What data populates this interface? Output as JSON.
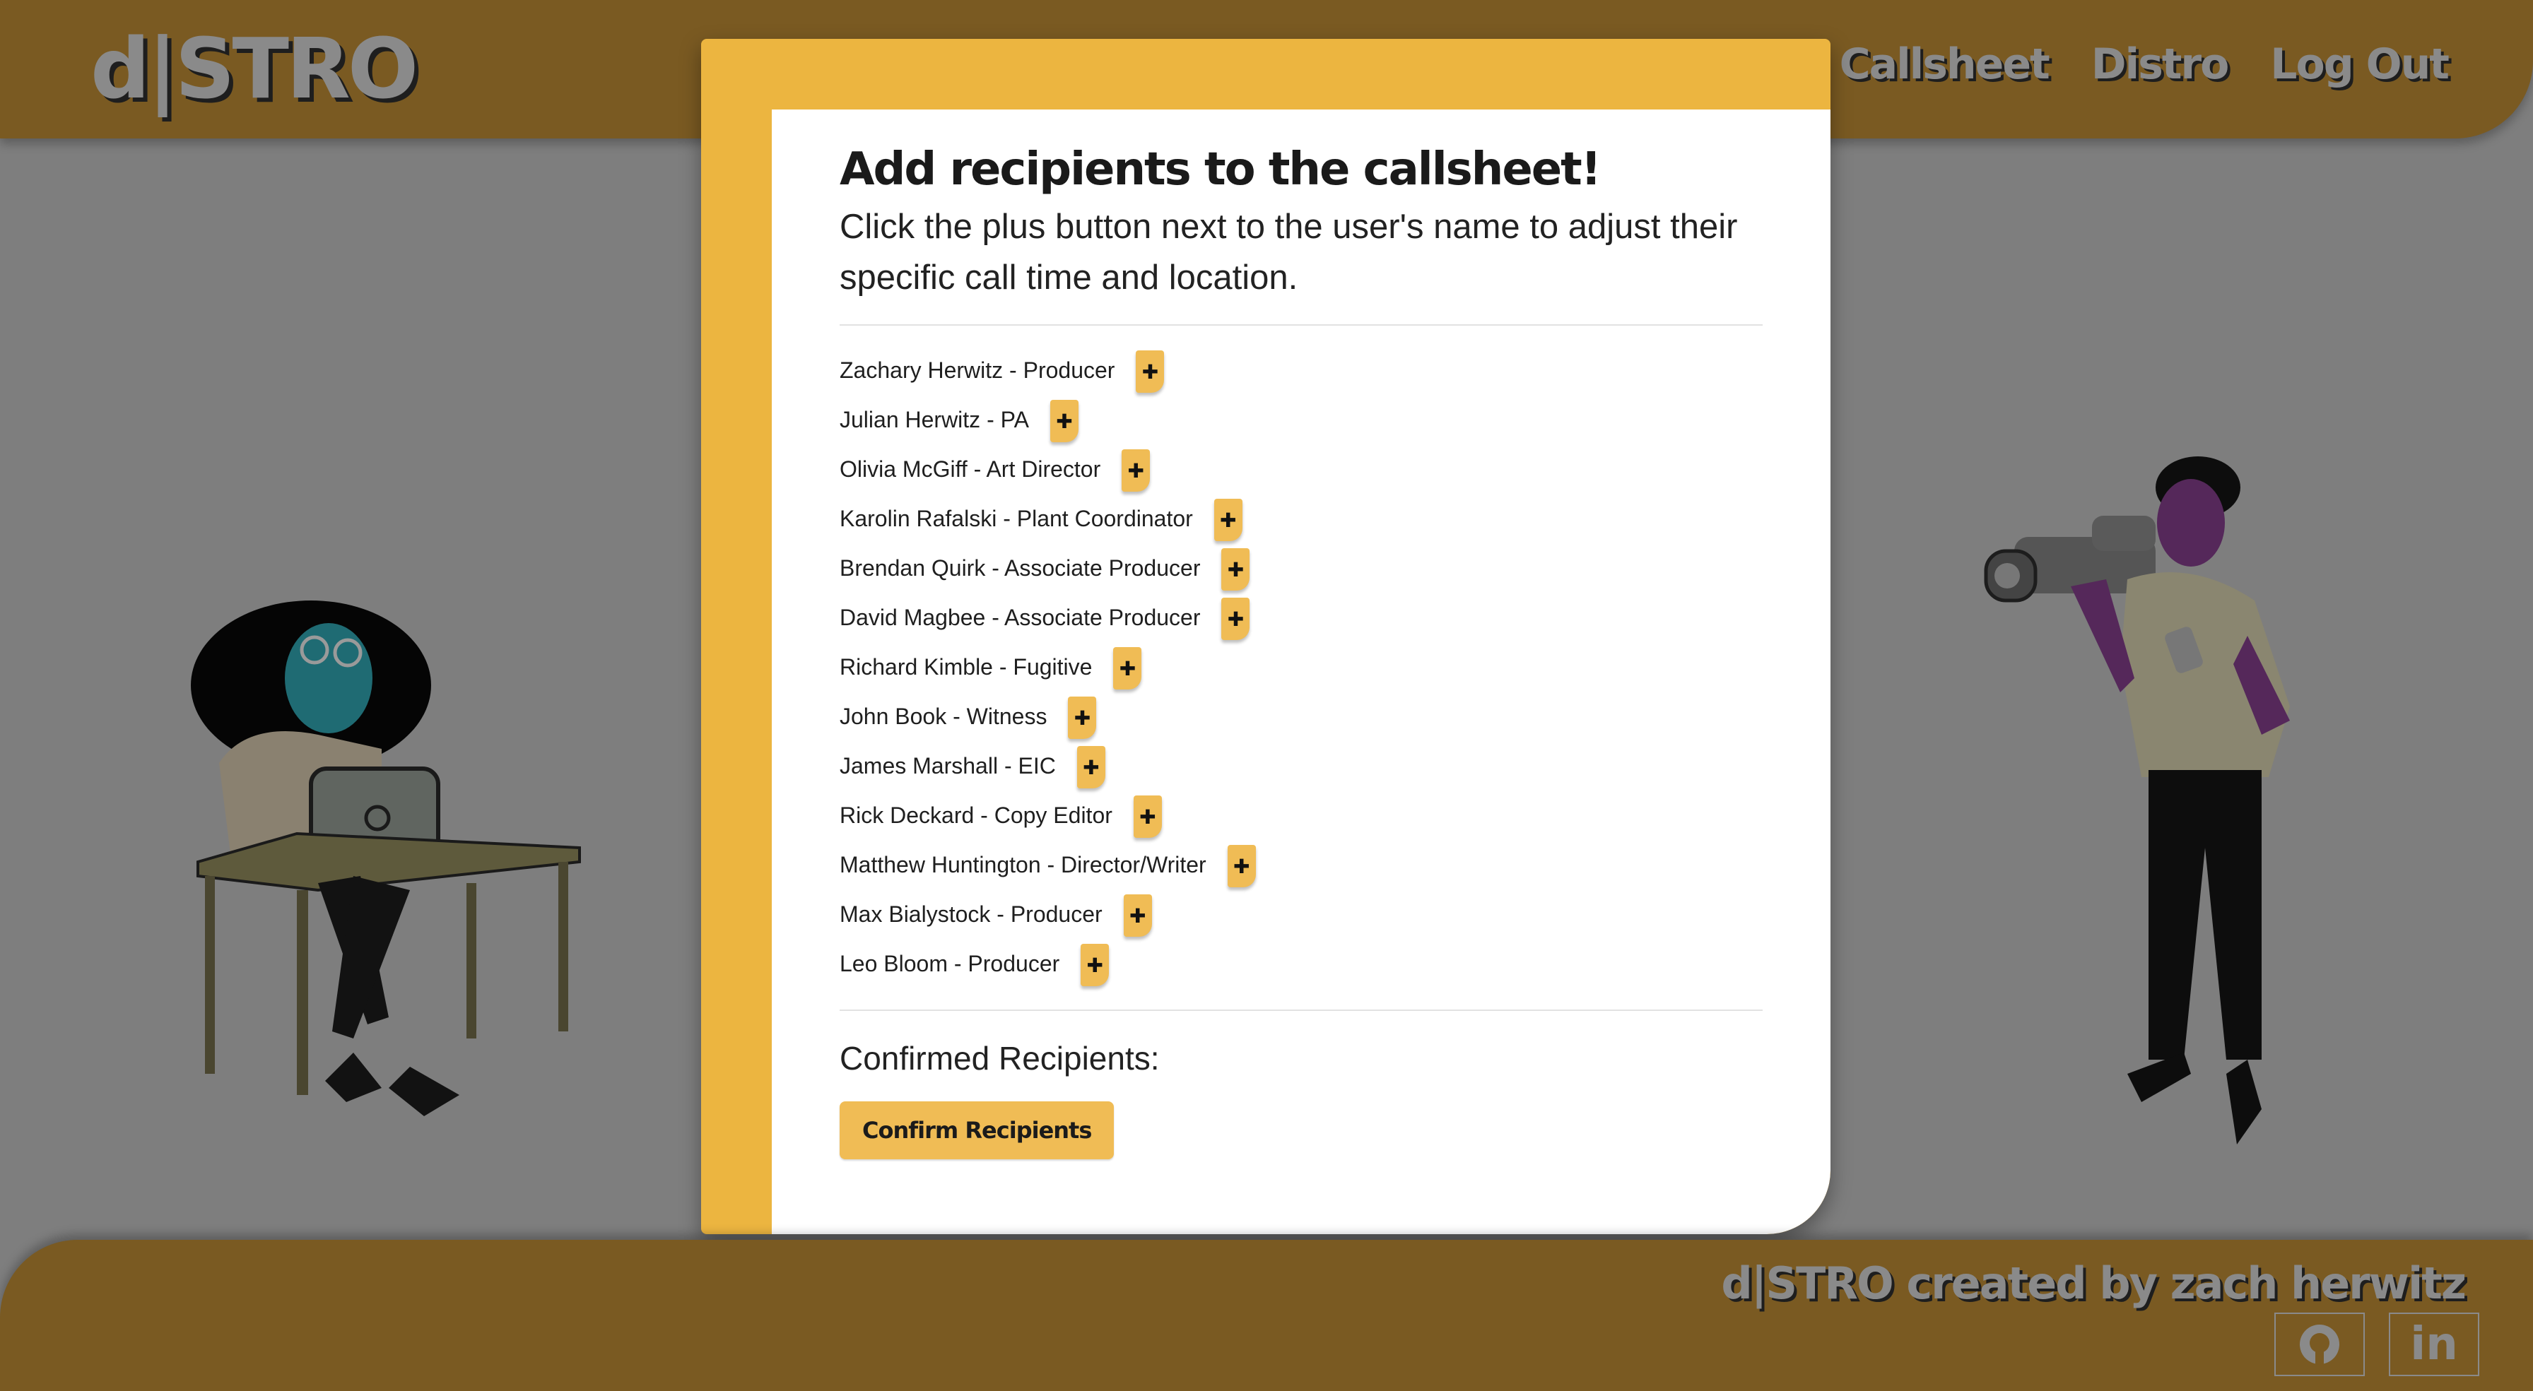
{
  "app": {
    "logo": "d|STRO"
  },
  "nav": {
    "items": [
      "Callsheet",
      "Distro",
      "Log Out"
    ]
  },
  "modal": {
    "heading": "Add recipients to the callsheet!",
    "instructions": "Click the plus button next to the user's name to adjust their specific call time and location.",
    "recipients": [
      "Zachary Herwitz - Producer",
      "Julian Herwitz - PA",
      "Olivia McGiff - Art Director",
      "Karolin Rafalski - Plant Coordinator",
      "Brendan Quirk - Associate Producer",
      "David Magbee - Associate Producer",
      "Richard Kimble - Fugitive",
      "John Book - Witness",
      "James Marshall - EIC",
      "Rick Deckard - Copy Editor",
      "Matthew Huntington - Director/Writer",
      "Max Bialystock - Producer",
      "Leo Bloom - Producer"
    ],
    "plus_icon": "plus-icon",
    "confirmed_label": "Confirmed Recipients:",
    "confirm_button": "Confirm Recipients"
  },
  "footer": {
    "credit": "d|STRO created by zach herwitz",
    "icons": [
      "github-icon",
      "linkedin-icon"
    ],
    "linkedin_text": "in"
  },
  "colors": {
    "brand_brown": "#7a5a22",
    "accent_yellow": "#ecb540",
    "button_yellow": "#f0bc55",
    "overlay_grey": "#7e7e7e"
  }
}
